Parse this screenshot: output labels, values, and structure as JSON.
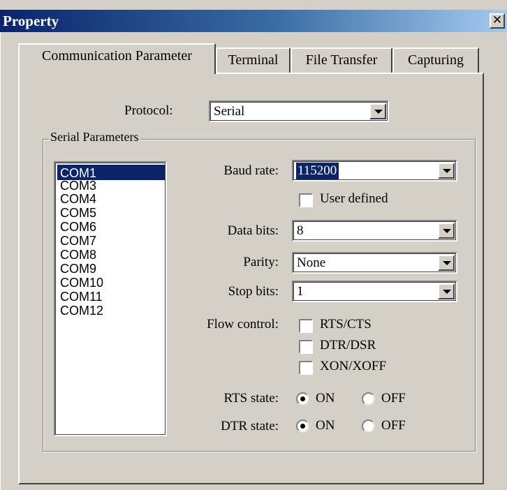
{
  "window": {
    "title": "Property",
    "close_glyph": "✕"
  },
  "tabs": [
    {
      "label": "Communication Parameter"
    },
    {
      "label": "Terminal"
    },
    {
      "label": "File Transfer"
    },
    {
      "label": "Capturing"
    }
  ],
  "protocol": {
    "label": "Protocol:",
    "value": "Serial"
  },
  "serial": {
    "group_title": "Serial Parameters",
    "ports": [
      "COM1",
      "COM3",
      "COM4",
      "COM5",
      "COM6",
      "COM7",
      "COM8",
      "COM9",
      "COM10",
      "COM11",
      "COM12"
    ],
    "selected_port": "COM1",
    "baud_rate": {
      "label": "Baud rate:",
      "value": "115200"
    },
    "user_defined": {
      "label": "User defined",
      "checked": false
    },
    "data_bits": {
      "label": "Data bits:",
      "value": "8"
    },
    "parity": {
      "label": "Parity:",
      "value": "None"
    },
    "stop_bits": {
      "label": "Stop bits:",
      "value": "1"
    },
    "flow_control": {
      "label": "Flow control:",
      "rts_cts": "RTS/CTS",
      "dtr_dsr": "DTR/DSR",
      "xon_xoff": "XON/XOFF"
    },
    "rts_state": {
      "label": "RTS state:",
      "on": "ON",
      "off": "OFF",
      "value": "ON"
    },
    "dtr_state": {
      "label": "DTR state:",
      "on": "ON",
      "off": "OFF",
      "value": "ON"
    }
  },
  "colors": {
    "title_bar": "#0a246a",
    "selection": "#0a246a",
    "face": "#d4d0c8"
  },
  "icons": {
    "close": "close-icon",
    "dropdown": "chevron-down-icon"
  }
}
